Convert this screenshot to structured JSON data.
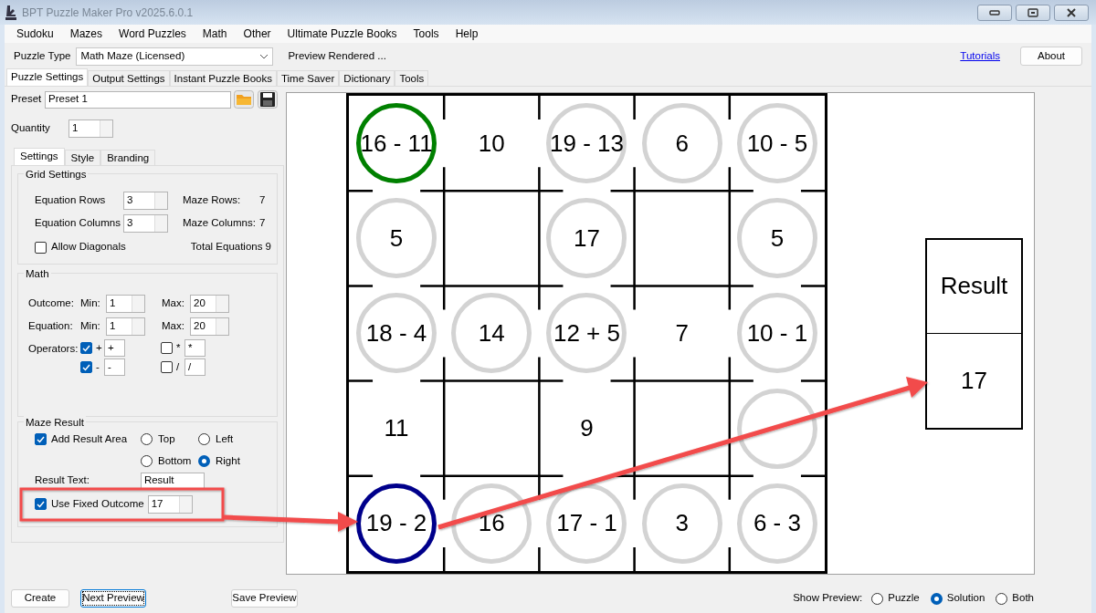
{
  "window": {
    "title": "BPT Puzzle Maker Pro v2025.6.0.1"
  },
  "menu": [
    "Sudoku",
    "Mazes",
    "Word Puzzles",
    "Math",
    "Other",
    "Ultimate Puzzle Books",
    "Tools",
    "Help"
  ],
  "toolbar": {
    "puzzle_type_label": "Puzzle Type",
    "puzzle_type": "Math Maze (Licensed)",
    "status": "Preview Rendered ...",
    "tutorials_link": "Tutorials",
    "about_button": "About"
  },
  "tabs": [
    {
      "label": "Puzzle Settings",
      "selected": true
    },
    {
      "label": "Output Settings",
      "selected": false
    },
    {
      "label": "Instant Puzzle Books",
      "selected": false
    },
    {
      "label": "Time Saver",
      "selected": false
    },
    {
      "label": "Dictionary",
      "selected": false
    },
    {
      "label": "Tools",
      "selected": false
    }
  ],
  "preset": {
    "label": "Preset",
    "value": "Preset 1"
  },
  "quantity": {
    "label": "Quantity",
    "value": "1"
  },
  "sub_tabs": [
    {
      "label": "Settings",
      "selected": true
    },
    {
      "label": "Style",
      "selected": false
    },
    {
      "label": "Branding",
      "selected": false
    }
  ],
  "grid_settings": {
    "title": "Grid Settings",
    "equation_rows": {
      "label": "Equation Rows",
      "value": "3"
    },
    "equation_columns": {
      "label": "Equation Columns",
      "value": "3"
    },
    "allow_diagonals": {
      "label": "Allow Diagonals",
      "checked": false
    },
    "maze_rows": {
      "label": "Maze Rows:",
      "value": "7"
    },
    "maze_columns": {
      "label": "Maze Columns:",
      "value": "7"
    },
    "total_equations": {
      "label": "Total Equations",
      "value": "9"
    }
  },
  "math": {
    "title": "Math",
    "rows": [
      {
        "label": "Outcome:",
        "min_label": "Min:",
        "min": "1",
        "max_label": "Max:",
        "max": "20"
      },
      {
        "label": "Equation:",
        "min_label": "Min:",
        "min": "1",
        "max_label": "Max:",
        "max": "20"
      }
    ],
    "operators_label": "Operators:",
    "operators": [
      {
        "symbol": "+",
        "value": "+",
        "checked": true
      },
      {
        "symbol": "*",
        "value": "*",
        "checked": false
      },
      {
        "symbol": "-",
        "value": "-",
        "checked": true
      },
      {
        "symbol": "/",
        "value": "/",
        "checked": false
      }
    ]
  },
  "maze_result": {
    "title": "Maze Result",
    "add_result_area": {
      "label": "Add Result Area",
      "checked": true
    },
    "positions": [
      {
        "label": "Top",
        "selected": false
      },
      {
        "label": "Left",
        "selected": false
      },
      {
        "label": "Bottom",
        "selected": false
      },
      {
        "label": "Right",
        "selected": true
      }
    ],
    "result_text_label": "Result Text:",
    "result_text": "Result",
    "use_fixed_outcome": {
      "label": "Use Fixed Outcome",
      "checked": true,
      "value": "17"
    }
  },
  "maze": {
    "rows": [
      [
        {
          "text": "16 - 11",
          "kind": "start"
        },
        {
          "text": "10",
          "kind": "plain"
        },
        {
          "text": "19 - 13",
          "kind": "circled"
        },
        {
          "text": "6",
          "kind": "circled"
        },
        {
          "text": "10 - 5",
          "kind": "circled"
        }
      ],
      [
        {
          "text": "5",
          "kind": "circled"
        },
        {
          "kind": "blank"
        },
        {
          "text": "17",
          "kind": "circled"
        },
        {
          "kind": "blank"
        },
        {
          "text": "5",
          "kind": "circled"
        }
      ],
      [
        {
          "text": "18 - 4",
          "kind": "circled"
        },
        {
          "text": "14",
          "kind": "circled"
        },
        {
          "text": "12 + 5",
          "kind": "circled"
        },
        {
          "text": "7",
          "kind": "plain"
        },
        {
          "text": "10 - 1",
          "kind": "circled"
        }
      ],
      [
        {
          "text": "11",
          "kind": "plain"
        },
        {
          "kind": "blank"
        },
        {
          "text": "9",
          "kind": "plain"
        },
        {
          "kind": "blank"
        },
        {
          "kind": "circled"
        }
      ],
      [
        {
          "text": "19 - 2",
          "kind": "end"
        },
        {
          "text": "16",
          "kind": "circled"
        },
        {
          "text": "17 - 1",
          "kind": "circled"
        },
        {
          "text": "3",
          "kind": "circled"
        },
        {
          "text": "6 - 3",
          "kind": "circled"
        }
      ]
    ]
  },
  "result_area": {
    "label": "Result",
    "value": "17"
  },
  "bottom": {
    "buttons": [
      {
        "label": "Create",
        "focused": false
      },
      {
        "label": "Next Preview",
        "focused": true
      },
      {
        "label": "Save Preview",
        "focused": false
      }
    ],
    "show_preview_label": "Show Preview:",
    "preview_options": [
      {
        "label": "Puzzle",
        "selected": false
      },
      {
        "label": "Solution",
        "selected": true
      },
      {
        "label": "Both",
        "selected": false
      }
    ]
  }
}
